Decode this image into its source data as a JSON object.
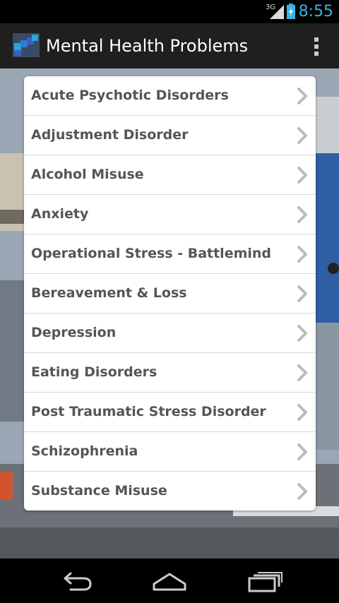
{
  "status_bar": {
    "network": "3G",
    "time": "8:55"
  },
  "action_bar": {
    "title": "Mental Health Problems",
    "app_icon": "app-logo-icon",
    "overflow_icon": "overflow-menu-icon"
  },
  "list": {
    "items": [
      {
        "label": "Acute Psychotic Disorders"
      },
      {
        "label": "Adjustment Disorder"
      },
      {
        "label": "Alcohol Misuse"
      },
      {
        "label": "Anxiety"
      },
      {
        "label": "Operational Stress - Battlemind"
      },
      {
        "label": "Bereavement & Loss"
      },
      {
        "label": "Depression"
      },
      {
        "label": "Eating Disorders"
      },
      {
        "label": "Post Traumatic Stress Disorder"
      },
      {
        "label": "Schizophrenia"
      },
      {
        "label": "Substance Misuse"
      }
    ],
    "chevron_icon": "chevron-right-icon"
  },
  "nav_bar": {
    "back_icon": "back-icon",
    "home_icon": "home-icon",
    "recents_icon": "recent-apps-icon"
  },
  "colors": {
    "accent": "#33b5e5",
    "action_bar_bg": "#1f1f1f",
    "list_text": "#555555",
    "chevron": "#bbbbbb"
  }
}
